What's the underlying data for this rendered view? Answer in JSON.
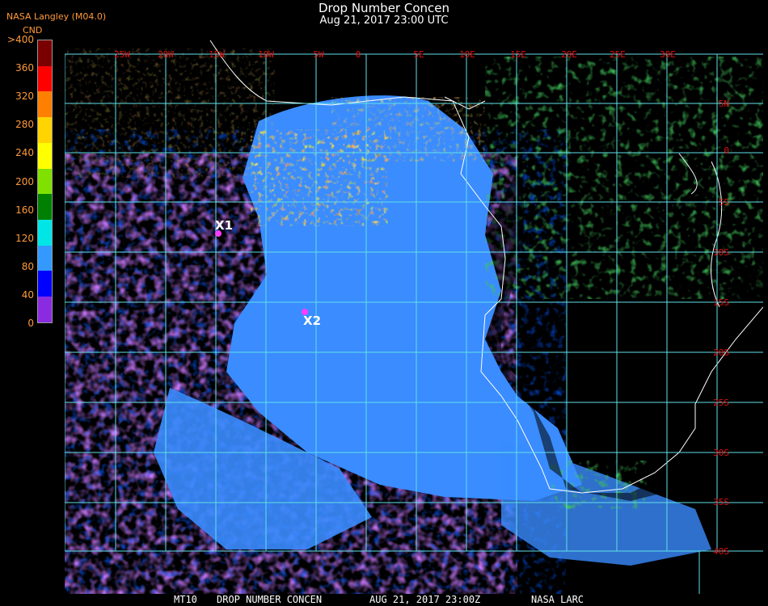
{
  "header": {
    "title": "Drop Number Concen",
    "datetime": "Aug 21, 2017 23:00 UTC",
    "org": "NASA Langley (M04.0)"
  },
  "colorbar": {
    "label": "CND",
    "ticks": [
      ">400",
      "360",
      "320",
      "280",
      "240",
      "200",
      "160",
      "120",
      "80",
      "40",
      "0"
    ],
    "colors": [
      "#7a0000",
      "#ff0000",
      "#ff7f00",
      "#ffd400",
      "#ffff00",
      "#80e000",
      "#008000",
      "#00e6e6",
      "#3399ff",
      "#0000ff",
      "#8a2be2"
    ]
  },
  "map": {
    "longitudes": [
      "25W",
      "20W",
      "15W",
      "10W",
      "5W",
      "0",
      "5E",
      "10E",
      "15E",
      "20E",
      "25E",
      "30E"
    ],
    "latitudes": [
      "5N",
      "0",
      "5S",
      "10S",
      "15S",
      "20S",
      "25S",
      "30S",
      "35S",
      "40S"
    ],
    "markers": [
      {
        "label": "X1"
      },
      {
        "label": "X2"
      }
    ],
    "colors": {
      "ocean_cloud": "#3399ff",
      "purple": "#8a2be2",
      "blue": "#0000ff",
      "grid": "#60e0e8",
      "land": "#000000"
    }
  },
  "footer": {
    "code": "MT10",
    "product": "DROP NUMBER CONCEN",
    "datetime": "AUG 21, 2017 23:00Z",
    "source": "NASA LARC"
  }
}
